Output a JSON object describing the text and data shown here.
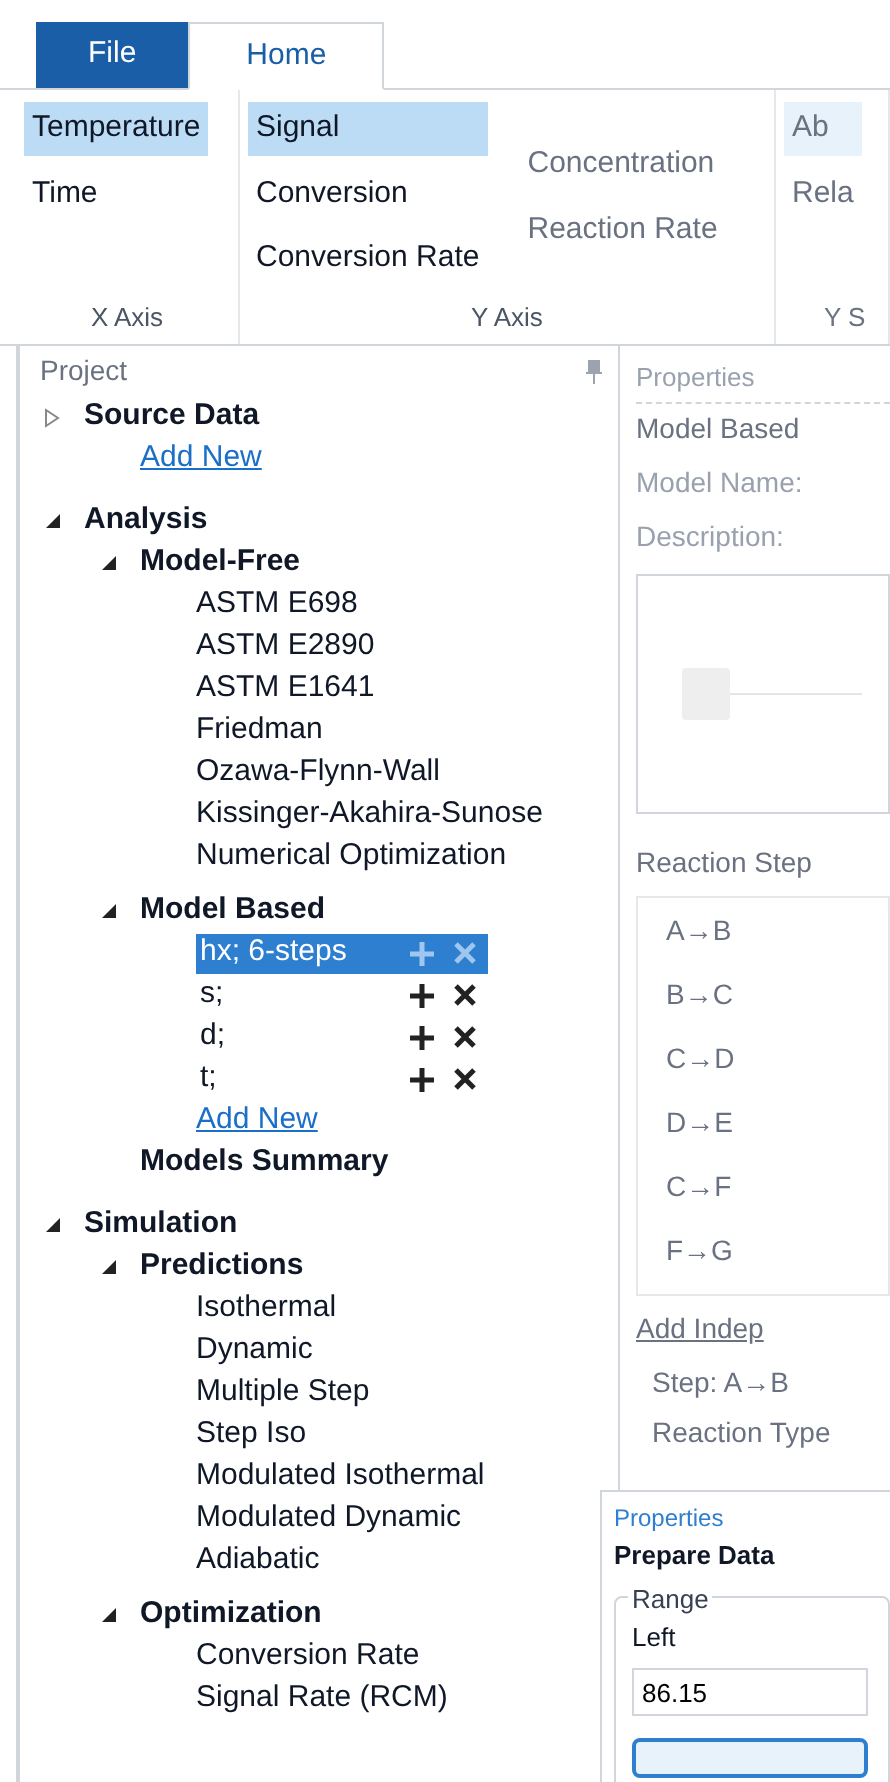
{
  "tabs": [
    {
      "label": "File",
      "selected": false
    },
    {
      "label": "Home",
      "selected": true
    }
  ],
  "ribbon": [
    {
      "label": "X Axis",
      "columns": [
        [
          {
            "label": "Temperature",
            "selected": true,
            "disabled": false
          },
          {
            "label": "Time",
            "selected": false,
            "disabled": false
          }
        ]
      ]
    },
    {
      "label": "Y Axis",
      "columns": [
        [
          {
            "label": "Signal",
            "selected": true,
            "disabled": false
          },
          {
            "label": "Conversion",
            "selected": false,
            "disabled": false
          },
          {
            "label": "Conversion Rate",
            "selected": false,
            "disabled": false
          }
        ],
        [
          {
            "label": "Concentration",
            "selected": false,
            "disabled": true
          },
          {
            "label": "Reaction Rate",
            "selected": false,
            "disabled": true
          }
        ]
      ]
    },
    {
      "label": "Y S",
      "columns": [
        [
          {
            "label": "Ab",
            "selected": true,
            "disabled": true
          },
          {
            "label": "Rela",
            "selected": false,
            "disabled": true
          }
        ]
      ]
    }
  ],
  "project": {
    "title": "Project",
    "tree": [
      {
        "label": "Source Data",
        "kind": "folder",
        "expanded": false,
        "children": [
          {
            "label": "Add New",
            "kind": "link"
          }
        ]
      },
      {
        "label": "Analysis",
        "kind": "folder",
        "expanded": true,
        "children": [
          {
            "label": "Model-Free",
            "kind": "folder",
            "expanded": true,
            "children": [
              {
                "label": "ASTM E698",
                "kind": "leaf"
              },
              {
                "label": "ASTM E2890",
                "kind": "leaf"
              },
              {
                "label": "ASTM E1641",
                "kind": "leaf"
              },
              {
                "label": "Friedman",
                "kind": "leaf"
              },
              {
                "label": "Ozawa-Flynn-Wall",
                "kind": "leaf"
              },
              {
                "label": "Kissinger-Akahira-Sunose",
                "kind": "leaf"
              },
              {
                "label": "Numerical Optimization",
                "kind": "leaf"
              }
            ]
          },
          {
            "label": "Model Based",
            "kind": "folder",
            "expanded": true,
            "children": [
              {
                "label": "hx; 6-steps",
                "kind": "model",
                "selected": true
              },
              {
                "label": "s;",
                "kind": "model",
                "selected": false
              },
              {
                "label": "d;",
                "kind": "model",
                "selected": false
              },
              {
                "label": "t;",
                "kind": "model",
                "selected": false
              },
              {
                "label": "Add New",
                "kind": "link"
              }
            ]
          },
          {
            "label": "Models Summary",
            "kind": "heading"
          }
        ]
      },
      {
        "label": "Simulation",
        "kind": "folder",
        "expanded": true,
        "children": [
          {
            "label": "Predictions",
            "kind": "folder",
            "expanded": true,
            "children": [
              {
                "label": "Isothermal",
                "kind": "leaf"
              },
              {
                "label": "Dynamic",
                "kind": "leaf"
              },
              {
                "label": "Multiple Step",
                "kind": "leaf"
              },
              {
                "label": "Step Iso",
                "kind": "leaf"
              },
              {
                "label": "Modulated Isothermal",
                "kind": "leaf"
              },
              {
                "label": "Modulated Dynamic",
                "kind": "leaf"
              },
              {
                "label": "Adiabatic",
                "kind": "leaf"
              }
            ]
          },
          {
            "label": "Optimization",
            "kind": "folder",
            "expanded": true,
            "children": [
              {
                "label": "Conversion Rate",
                "kind": "leaf"
              },
              {
                "label": "Signal Rate (RCM)",
                "kind": "leaf"
              }
            ]
          }
        ]
      }
    ]
  },
  "properties": {
    "title": "Properties",
    "section": "Model Based",
    "fields": [
      "Model Name:",
      "Description:"
    ],
    "steps_label": "Reaction Step",
    "steps": [
      "A→B",
      "B→C",
      "C→D",
      "D→E",
      "C→F",
      "F→G"
    ],
    "link": "Add Indep",
    "step": "Step: A→B",
    "reaction_type": "Reaction Type"
  },
  "prepare": {
    "title": "Properties",
    "heading": "Prepare Data",
    "group": "Range",
    "field_label": "Left",
    "value": "86.15"
  }
}
